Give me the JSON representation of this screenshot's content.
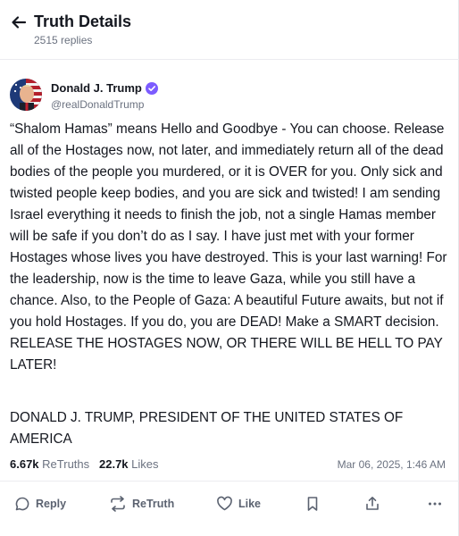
{
  "header": {
    "title": "Truth Details",
    "replies": "2515 replies"
  },
  "author": {
    "name": "Donald J. Trump",
    "handle": "@realDonaldTrump"
  },
  "post": {
    "text": "“Shalom Hamas” means Hello and Goodbye - You can choose. Release all of the Hostages now, not later, and immediately return all of the dead bodies of the people you murdered, or it is OVER for you. Only sick and twisted people keep bodies, and you are sick and twisted! I am sending Israel everything it needs to finish the job, not a single Hamas member will be safe if you don’t do as I say. I have just met with your former Hostages whose lives you have destroyed. This is your last warning! For the leadership, now is the time to leave Gaza, while you still have a chance. Also, to the People of Gaza: A beautiful Future awaits, but not if you hold Hostages. If you do, you are DEAD! Make a SMART decision. RELEASE THE HOSTAGES NOW, OR THERE WILL BE HELL TO PAY LATER!",
    "signature": "DONALD J. TRUMP, PRESIDENT OF THE UNITED STATES OF AMERICA"
  },
  "stats": {
    "retruths_count": "6.67k",
    "retruths_label": "ReTruths",
    "likes_count": "22.7k",
    "likes_label": "Likes",
    "date": "Mar 06, 2025, 1:46 AM"
  },
  "actions": {
    "reply": "Reply",
    "retruth": "ReTruth",
    "like": "Like"
  },
  "colors": {
    "verified": "#7c5cff",
    "text": "#14171f",
    "muted": "#6b7280"
  }
}
